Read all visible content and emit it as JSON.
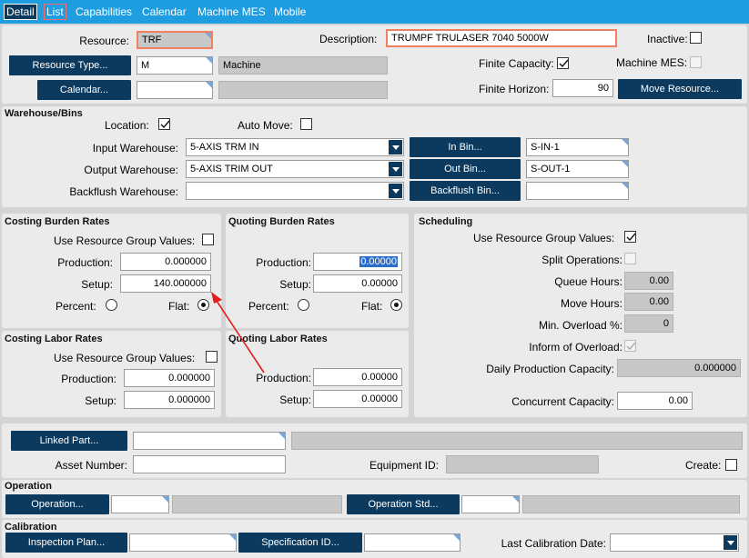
{
  "tabs": [
    "Detail",
    "List",
    "Capabilities",
    "Calendar",
    "Machine MES",
    "Mobile"
  ],
  "header": {
    "resource_label": "Resource:",
    "resource_value": "TRF",
    "description_label": "Description:",
    "description_value": "TRUMPF TRULASER 7040 5000W",
    "inactive_label": "Inactive:",
    "resource_type_btn": "Resource Type...",
    "resource_type_value": "M",
    "resource_type_desc": "Machine",
    "finite_capacity_label": "Finite Capacity:",
    "machine_mes_label": "Machine MES:",
    "calendar_btn": "Calendar...",
    "calendar_value": "",
    "calendar_desc": "",
    "finite_horizon_label": "Finite Horizon:",
    "finite_horizon_value": "90",
    "move_resource_btn": "Move Resource..."
  },
  "warehouse": {
    "title": "Warehouse/Bins",
    "location_label": "Location:",
    "auto_move_label": "Auto Move:",
    "input_wh_label": "Input Warehouse:",
    "input_wh_value": "5-AXIS TRM IN",
    "in_bin_btn": "In Bin...",
    "in_bin_value": "S-IN-1",
    "output_wh_label": "Output Warehouse:",
    "output_wh_value": "5-AXIS TRIM OUT",
    "out_bin_btn": "Out Bin...",
    "out_bin_value": "S-OUT-1",
    "backflush_wh_label": "Backflush Warehouse:",
    "backflush_wh_value": "",
    "backflush_bin_btn": "Backflush Bin...",
    "backflush_bin_value": ""
  },
  "costing_burden": {
    "title": "Costing Burden Rates",
    "use_group_label": "Use Resource Group Values:",
    "production_label": "Production:",
    "production_value": "0.000000",
    "setup_label": "Setup:",
    "setup_value": "140.000000",
    "percent_label": "Percent:",
    "flat_label": "Flat:"
  },
  "quoting_burden": {
    "title": "Quoting Burden Rates",
    "production_label": "Production:",
    "production_value": "0.00000",
    "setup_label": "Setup:",
    "setup_value": "0.00000",
    "percent_label": "Percent:",
    "flat_label": "Flat:"
  },
  "scheduling": {
    "title": "Scheduling",
    "use_group_label": "Use Resource Group Values:",
    "split_ops_label": "Split Operations:",
    "queue_label": "Queue Hours:",
    "queue_value": "0.00",
    "move_label": "Move Hours:",
    "move_value": "0.00",
    "min_overload_label": "Min. Overload %:",
    "min_overload_value": "0",
    "inform_label": "Inform of Overload:",
    "daily_label": "Daily Production Capacity:",
    "daily_value": "0.000000",
    "concurrent_label": "Concurrent Capacity:",
    "concurrent_value": "0.00"
  },
  "costing_labor": {
    "title": "Costing Labor Rates",
    "use_group_label": "Use Resource Group Values:",
    "production_label": "Production:",
    "production_value": "0.000000",
    "setup_label": "Setup:",
    "setup_value": "0.000000"
  },
  "quoting_labor": {
    "title": "Quoting Labor Rates",
    "production_label": "Production:",
    "production_value": "0.00000",
    "setup_label": "Setup:",
    "setup_value": "0.00000"
  },
  "linked": {
    "linked_part_btn": "Linked Part...",
    "asset_label": "Asset Number:",
    "equipment_label": "Equipment ID:",
    "create_label": "Create:"
  },
  "operation": {
    "title": "Operation",
    "operation_btn": "Operation...",
    "operation_std_btn": "Operation Std..."
  },
  "calibration": {
    "title": "Calibration",
    "inspection_btn": "Inspection Plan...",
    "spec_btn": "Specification ID...",
    "last_cal_label": "Last Calibration Date:"
  },
  "colors": {
    "tab_bar": "#1e9ee0",
    "button": "#0b3a5e",
    "annotation_arrow": "#e02020"
  }
}
